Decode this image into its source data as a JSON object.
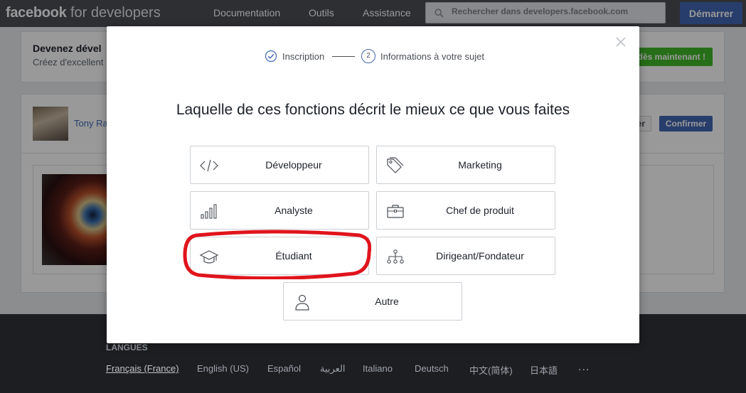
{
  "header": {
    "logo_bold": "facebook",
    "logo_rest": " for developers",
    "nav": [
      "Documentation",
      "Outils",
      "Assistance"
    ],
    "search_placeholder": "Rechercher dans developers.facebook.com",
    "start_button": "Démarrer"
  },
  "background": {
    "banner_title": "Devenez dével",
    "banner_subtitle": "Créez d'excellent",
    "banner_button": "dès maintenant !",
    "profile_name": "Tony Ra",
    "ignore_button": "rer",
    "confirm_button": "Confirmer"
  },
  "modal": {
    "step1": "Inscription",
    "step2_number": "2",
    "step2": "Informations à votre sujet",
    "question": "Laquelle de ces fonctions décrit le mieux ce que vous faites",
    "options": [
      {
        "label": "Développeur",
        "icon": "code-icon"
      },
      {
        "label": "Marketing",
        "icon": "tags-icon"
      },
      {
        "label": "Analyste",
        "icon": "bar-chart-icon"
      },
      {
        "label": "Chef de produit",
        "icon": "briefcase-icon"
      },
      {
        "label": "Étudiant",
        "icon": "graduation-cap-icon"
      },
      {
        "label": "Dirigeant/Fondateur",
        "icon": "org-chart-icon"
      },
      {
        "label": "Autre",
        "icon": "person-icon"
      }
    ],
    "highlight_color": "#e0141c"
  },
  "footer": {
    "languages_title": "LANGUES",
    "languages": [
      "Français (France)",
      "English (US)",
      "Español",
      "العربية",
      "Italiano",
      "Deutsch",
      "中文(简体)",
      "日本語"
    ],
    "more": "..."
  }
}
